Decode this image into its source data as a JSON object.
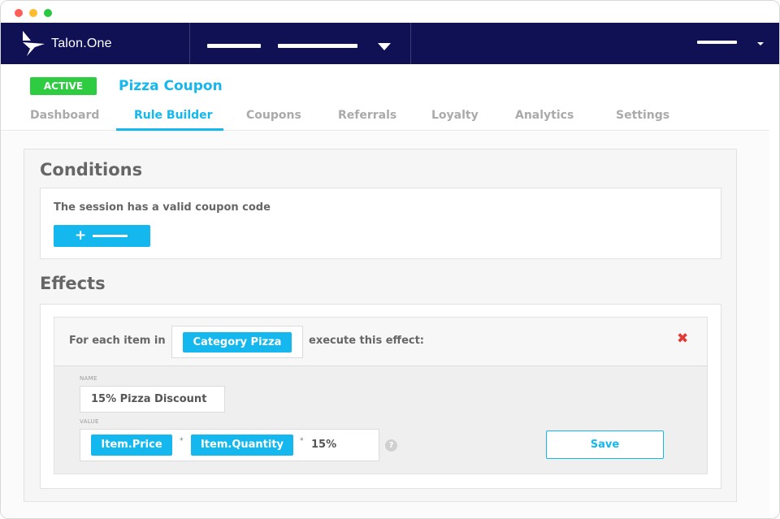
{
  "app": {
    "brand": "Talon.One"
  },
  "campaign": {
    "status": "ACTIVE",
    "title": "Pizza Coupon"
  },
  "tabs": [
    {
      "label": "Dashboard",
      "active": false
    },
    {
      "label": "Rule Builder",
      "active": true
    },
    {
      "label": "Coupons",
      "active": false
    },
    {
      "label": "Referrals",
      "active": false
    },
    {
      "label": "Loyalty",
      "active": false
    },
    {
      "label": "Analytics",
      "active": false
    },
    {
      "label": "Settings",
      "active": false
    }
  ],
  "conditions": {
    "title": "Conditions",
    "items": [
      {
        "text": "The session has a valid coupon code"
      }
    ],
    "add_button_icon": "plus-icon"
  },
  "effects": {
    "title": "Effects",
    "header": {
      "prefix": "For each item in",
      "collection": "Category Pizza",
      "suffix": "execute this effect:"
    },
    "delete_icon": "✖",
    "name_label": "NAME",
    "name_value": "15% Pizza Discount",
    "value_label": "VALUE",
    "value_terms": [
      "Item.Price",
      "Item.Quantity"
    ],
    "operator": "*",
    "value_tail": "15%",
    "help_icon": "?",
    "save_label": "Save"
  },
  "colors": {
    "navbar": "#0f1154",
    "accent": "#14b8ee",
    "active_badge": "#2ecc40",
    "delete": "#e53935"
  }
}
